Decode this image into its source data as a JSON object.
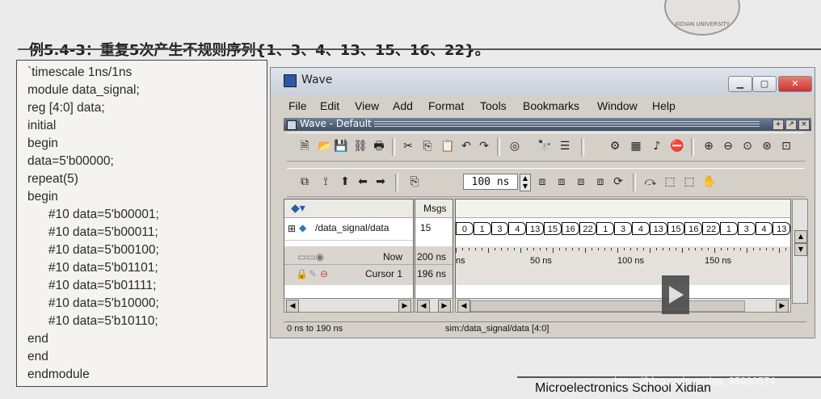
{
  "slide": {
    "title": "例5.4-3：重复5次产生不规则序列{1、3、4、13、15、16、22}。",
    "logo_text": "XIDIAN UNIVERSITY",
    "footer": "Microelectronics School  Xidian",
    "watermark": "https://blog.csdn.net/qq_35990574"
  },
  "code": {
    "lines": [
      "`timescale 1ns/1ns",
      "module data_signal;",
      "reg [4:0] data;",
      "initial",
      "begin",
      "data=5'b00000;",
      "repeat(5)",
      "begin",
      "      #10 data=5'b00001;",
      "      #10 data=5'b00011;",
      "      #10 data=5'b00100;",
      "      #10 data=5'b01101;",
      "      #10 data=5'b01111;",
      "      #10 data=5'b10000;",
      "      #10 data=5'b10110;",
      "end",
      "end",
      "endmodule"
    ]
  },
  "wave_window": {
    "title": "Wave",
    "menu": [
      "File",
      "Edit",
      "View",
      "Add",
      "Format",
      "Tools",
      "Bookmarks",
      "Window",
      "Help"
    ],
    "subwindow_title": "Wave - Default",
    "zoom_value": "100 ns",
    "msgs_header": "Msgs",
    "signal_name": "/data_signal/data",
    "signal_value": "15",
    "now_label": "Now",
    "now_value": "200 ns",
    "cursor_label": "Cursor 1",
    "cursor_value": "196 ns",
    "wave_values": [
      "0",
      "1",
      "3",
      "4",
      "13",
      "15",
      "16",
      "22",
      "1",
      "3",
      "4",
      "13",
      "15",
      "16",
      "22",
      "1",
      "3",
      "4",
      "13"
    ],
    "time_labels": [
      "ns",
      "50 ns",
      "100 ns",
      "150 ns"
    ],
    "status_left": "0 ns to 190 ns",
    "status_right": "sim:/data_signal/data [4:0]"
  }
}
